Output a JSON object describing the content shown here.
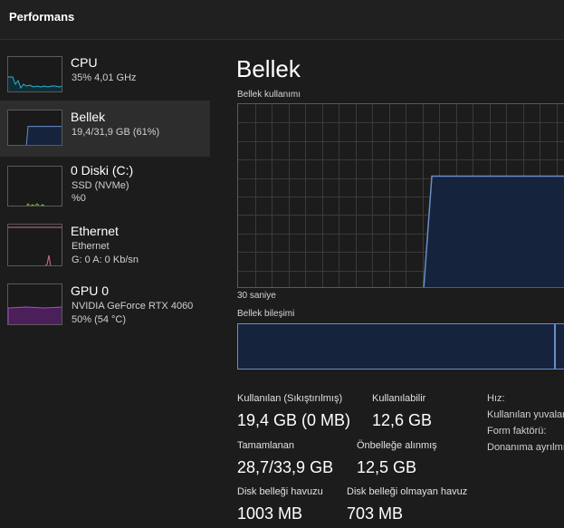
{
  "header": {
    "title": "Performans"
  },
  "sidebar": {
    "items": [
      {
        "title": "CPU",
        "sub1": "35%  4,01 GHz",
        "sub2": "",
        "graph_color": "#2fb4d4"
      },
      {
        "title": "Bellek",
        "sub1": "19,4/31,9 GB (61%)",
        "sub2": "",
        "graph_color": "#6a8ec8",
        "usage": 0.61
      },
      {
        "title": "0 Diski (C:)",
        "sub1": "SSD (NVMe)",
        "sub2": "%0",
        "graph_color": "#7fbf3f"
      },
      {
        "title": "Ethernet",
        "sub1": "Ethernet",
        "sub2": "G: 0 A: 0 Kb/sn",
        "graph_color": "#d66f8e"
      },
      {
        "title": "GPU 0",
        "sub1": "NVIDIA GeForce RTX 4060",
        "sub2": "50%  (54 °C)",
        "graph_color": "#a64cc8",
        "usage": 0.5
      }
    ]
  },
  "main": {
    "title": "Bellek",
    "usage_label": "Bellek kullanımı",
    "time_label": "30 saniye",
    "composition_label": "Bellek bileşimi",
    "memory_used_fraction": 0.61,
    "stats": [
      {
        "label": "Kullanılan (Sıkıştırılmış)",
        "value": "19,4 GB (0 MB)"
      },
      {
        "label": "Kullanılabilir",
        "value": "12,6 GB"
      },
      {
        "label": "Tamamlanan",
        "value": "28,7/33,9 GB"
      },
      {
        "label": "Önbelleğe alınmış",
        "value": "12,5 GB"
      },
      {
        "label": "Disk belleği havuzu",
        "value": "1003 MB"
      },
      {
        "label": "Disk belleği olmayan havuz",
        "value": "703 MB"
      }
    ],
    "info": [
      {
        "label": "Hız:"
      },
      {
        "label": "Kullanılan yuvalar:"
      },
      {
        "label": "Form faktörü:"
      },
      {
        "label": "Donanıma ayrılmış:"
      }
    ]
  },
  "colors": {
    "memory_line": "#6a8ec8",
    "memory_fill": "#16233c",
    "grid": "#3a3a3a"
  }
}
